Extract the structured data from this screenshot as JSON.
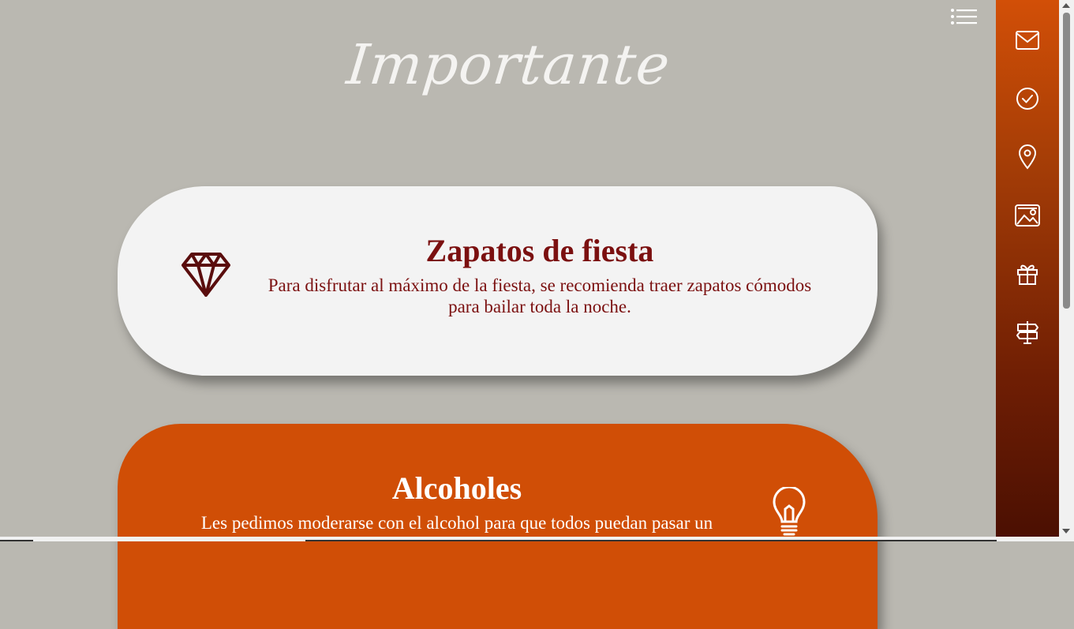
{
  "page": {
    "title": "Importante"
  },
  "menu": {
    "icon": "list-icon"
  },
  "cards": [
    {
      "icon": "diamond-icon",
      "title": "Zapatos de fiesta",
      "body": "Para disfrutar al máximo de la fiesta, se recomienda traer zapatos cómodos para bailar toda la noche."
    },
    {
      "icon": "lightbulb-icon",
      "title": "Alcoholes",
      "body": "Les pedimos moderarse con el alcohol para que todos puedan pasar un"
    }
  ],
  "sidebar": {
    "items": [
      {
        "icon": "envelope-icon"
      },
      {
        "icon": "check-circle-icon"
      },
      {
        "icon": "location-pin-icon"
      },
      {
        "icon": "gallery-icon"
      },
      {
        "icon": "gift-icon"
      },
      {
        "icon": "signpost-icon"
      }
    ]
  },
  "colors": {
    "background": "#bab8b1",
    "accent": "#d04e06",
    "title_text": "#7b1010",
    "card_light": "#f3f3f3"
  }
}
